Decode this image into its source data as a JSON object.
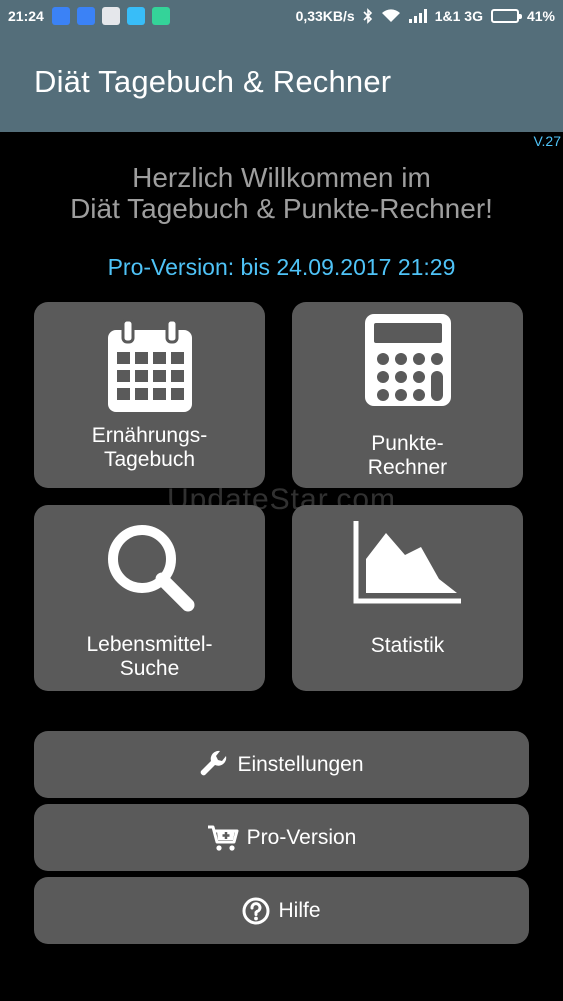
{
  "status_bar": {
    "time": "21:24",
    "net_speed": "0,33KB/s",
    "carrier": "1&1 3G",
    "battery": "41%",
    "battery_level": 0.41,
    "notification_icons": [
      "mail-icon",
      "mail-icon",
      "app-icon",
      "app-icon",
      "app-icon"
    ],
    "battery_color": "#f39c12"
  },
  "app_bar": {
    "title": "Diät Tagebuch & Rechner"
  },
  "version": "V.27",
  "welcome": {
    "line1": "Herzlich Willkommen im",
    "line2": "Diät Tagebuch & Punkte-Rechner!"
  },
  "pro_status": "Pro-Version: bis 24.09.2017 21:29",
  "tiles": [
    {
      "label1": "Ernährungs-",
      "label2": "Tagebuch",
      "icon": "calendar-icon"
    },
    {
      "label1": "Punkte-",
      "label2": "Rechner",
      "icon": "calculator-icon"
    },
    {
      "label1": "Lebensmittel-",
      "label2": "Suche",
      "icon": "search-icon"
    },
    {
      "label1": "Statistik",
      "label2": "",
      "icon": "area-chart-icon"
    }
  ],
  "watermark": "UpdateStar.com",
  "buttons": {
    "settings": {
      "label": "Einstellungen",
      "icon": "wrench-icon"
    },
    "pro": {
      "label": "Pro-Version",
      "icon": "cart-plus-icon"
    },
    "help": {
      "label": "Hilfe",
      "icon": "help-circle-icon"
    }
  },
  "colors": {
    "app_bar": "#546e7a",
    "accent": "#4fc3f7",
    "tile": "#5a5a5a",
    "background": "#000000",
    "welcome_text": "#9e9e9e"
  }
}
